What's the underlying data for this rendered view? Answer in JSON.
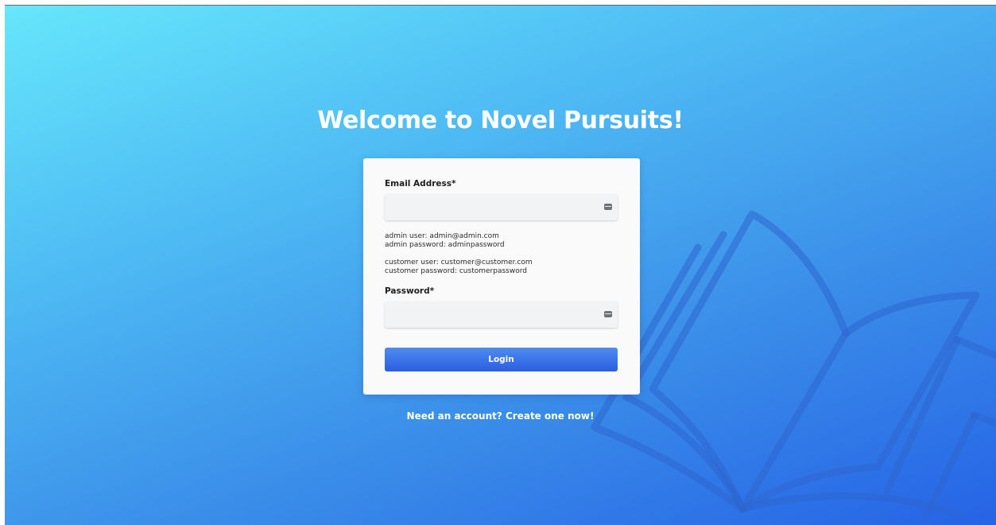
{
  "page": {
    "title": "Welcome to Novel Pursuits!"
  },
  "form": {
    "email_label": "Email Address*",
    "email_value": "",
    "email_placeholder": "",
    "hints": {
      "admin_user": "admin user: admin@admin.com",
      "admin_password": "admin password: adminpassword",
      "customer_user": "customer user: customer@customer.com",
      "customer_password": "customer password: customerpassword"
    },
    "password_label": "Password*",
    "password_value": "",
    "password_placeholder": "",
    "login_label": "Login"
  },
  "footer": {
    "signup_link": "Need an account? Create one now!"
  },
  "icons": {
    "field_autofill": "autofill-card-icon",
    "background": "open-book-icon"
  },
  "colors": {
    "gradient_start": "#66e6fb",
    "gradient_end": "#2663e6",
    "button": "#3a72e8",
    "card": "#fafafa"
  }
}
